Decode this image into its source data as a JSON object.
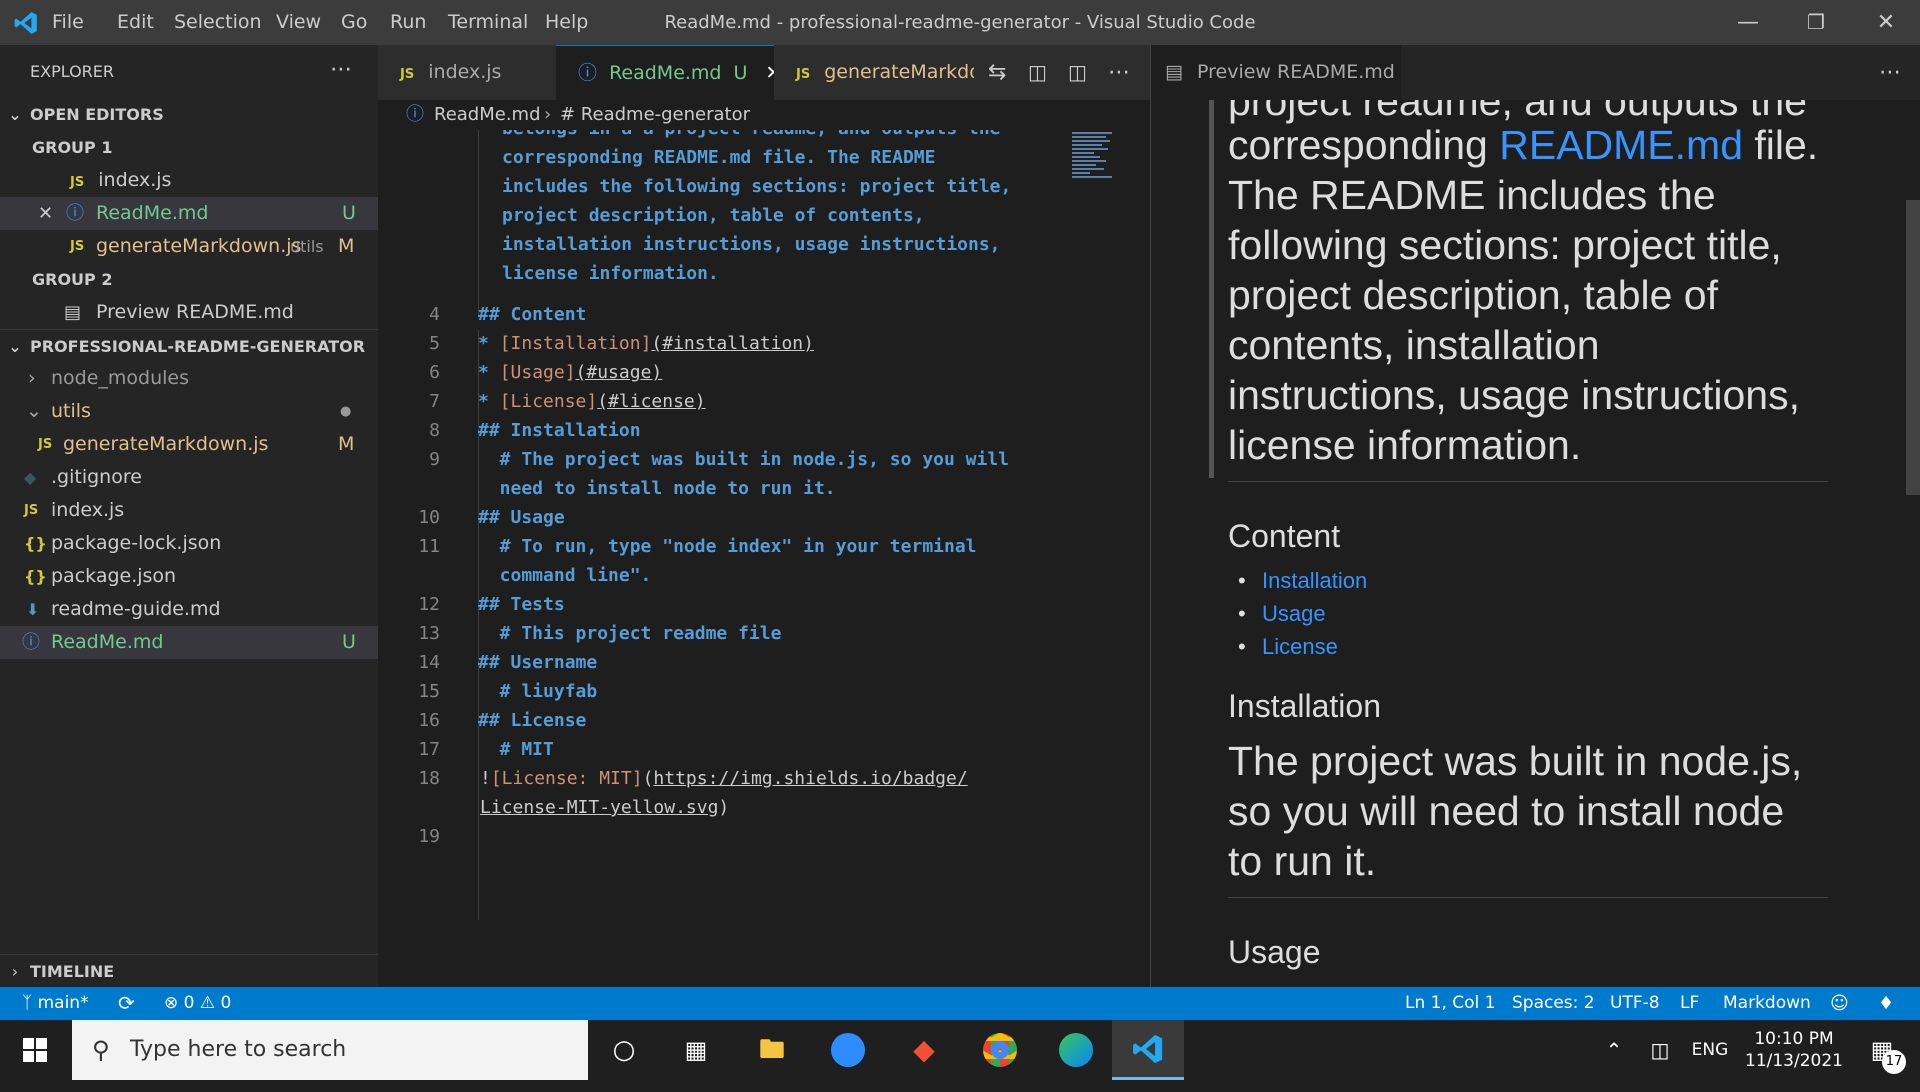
{
  "window": {
    "title": "ReadMe.md - professional-readme-generator - Visual Studio Code",
    "menu": [
      "File",
      "Edit",
      "Selection",
      "View",
      "Go",
      "Run",
      "Terminal",
      "Help"
    ]
  },
  "explorer": {
    "title": "EXPLORER",
    "open_editors": "OPEN EDITORS",
    "group1": "GROUP 1",
    "group2": "GROUP 2",
    "g1_index": "index.js",
    "g1_readme": "ReadMe.md",
    "g1_readme_badge": "U",
    "g1_gen": "generateMarkdown.js",
    "g1_gen_dir": "utils",
    "g1_gen_badge": "M",
    "g2_preview": "Preview README.md",
    "project": "PROFESSIONAL-README-GENERATOR",
    "node_modules": "node_modules",
    "utils": "utils",
    "gen": "generateMarkdown.js",
    "gen_badge": "M",
    "gitignore": ".gitignore",
    "index": "index.js",
    "pkglock": "package-lock.json",
    "pkg": "package.json",
    "guide": "readme-guide.md",
    "readme": "ReadMe.md",
    "readme_badge": "U",
    "timeline": "TIMELINE",
    "js": "JS"
  },
  "tabs": {
    "index": "index.js",
    "readme": "ReadMe.md",
    "readme_badge": "U",
    "gen": "generateMarkdow",
    "preview": "Preview README.md"
  },
  "breadcrumb": {
    "file": "ReadMe.md",
    "symbol": "# Readme-generator"
  },
  "editor": {
    "wrap_lines": [
      "belongs in a a project readme, and outputs the",
      "corresponding README.md file. The README",
      "includes the following sections: project title,",
      "project description, table of contents,",
      "installation instructions, usage instructions,",
      "license information."
    ],
    "l4": "## Content",
    "l5a": "[Installation]",
    "l5b": "(#installation)",
    "l6a": "[Usage]",
    "l6b": "(#usage)",
    "l7a": "[License]",
    "l7b": "(#license)",
    "l8": "## Installation",
    "l9a": "  # The project was built in node.js, so you will",
    "l9b": "  need to install node to run it.",
    "l10": "## Usage",
    "l11a": "  # To run, type \"node index\" in your terminal",
    "l11b": "  command line\".",
    "l12": "## Tests",
    "l13": "  # This project readme file",
    "l14": "## Username",
    "l15": "  # liuyfab",
    "l16": "## License",
    "l17": "  # MIT",
    "l18a": "[License: MIT]",
    "l18b": "https://img.shields.io/badge/",
    "l18c": "License-MIT-yellow.svg",
    "numbers": [
      "4",
      "5",
      "6",
      "7",
      "8",
      "9",
      "10",
      "11",
      "12",
      "13",
      "14",
      "15",
      "16",
      "17",
      "18",
      "19"
    ]
  },
  "preview": {
    "cut_line": "project readme, and outputs the",
    "p1a": "corresponding ",
    "p1link": "README.md",
    "p1b": " file.",
    "p2": "The README includes the",
    "p3": "following sections: project title,",
    "p4": "project description, table of",
    "p5": "contents, installation",
    "p6": "instructions, usage instructions,",
    "p7": "license information.",
    "h_content": "Content",
    "li1": "Installation",
    "li2": "Usage",
    "li3": "License",
    "h_install": "Installation",
    "i1": "The project was built in node.js,",
    "i2": "so you will need to install node",
    "i3": "to run it.",
    "h_usage": "Usage"
  },
  "status": {
    "branch": "main*",
    "errors": "0",
    "warnings": "0",
    "position": "Ln 1, Col 1",
    "spaces": "Spaces: 2",
    "encoding": "UTF-8",
    "eol": "LF",
    "language": "Markdown"
  },
  "taskbar": {
    "search_placeholder": "Type here to search",
    "lang": "ENG",
    "time": "10:10 PM",
    "date": "11/13/2021",
    "notif_count": "17"
  },
  "colors": {
    "accent": "#007acc",
    "link": "#3794ff",
    "git_untracked": "#73c991",
    "md_heading": "#569cd6",
    "md_link_text": "#ce9178"
  }
}
